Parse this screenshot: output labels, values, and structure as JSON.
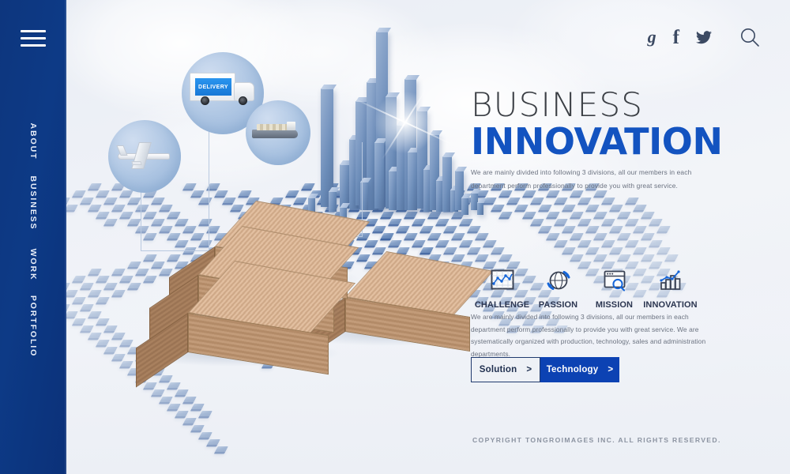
{
  "sidebar": {
    "menu_icon": "hamburger-menu-icon",
    "items": [
      {
        "label": "ABOUT"
      },
      {
        "label": "BUSINESS"
      },
      {
        "label": "WORK"
      },
      {
        "label": "PORTFOLIO"
      }
    ]
  },
  "header": {
    "icons": [
      {
        "name": "google-plus-icon",
        "glyph": "g"
      },
      {
        "name": "facebook-icon",
        "glyph": "f"
      },
      {
        "name": "twitter-icon",
        "glyph": "twitter-bird"
      },
      {
        "name": "search-icon",
        "glyph": "magnifier"
      }
    ]
  },
  "hero": {
    "title_line1": "BUSINESS",
    "title_line2": "INNOVATION",
    "lead_paragraph": "We are mainly divided into following 3 divisions, all our members in each department perform professionally to provide you with great service."
  },
  "features": [
    {
      "label": "CHALLENGE",
      "icon": "line-chart-frame-icon"
    },
    {
      "label": "PASSION",
      "icon": "globe-refresh-icon"
    },
    {
      "label": "MISSION",
      "icon": "browser-search-icon"
    },
    {
      "label": "INNOVATION",
      "icon": "bar-chart-trend-icon"
    }
  ],
  "body": {
    "paragraph": "We are mainly divided into following 3 divisions, all our members in each department perform professionally to provide you with great service. We are systematically organized with production, technology, sales and administration departments."
  },
  "buttons": {
    "solution": {
      "label": "Solution",
      "chevron": ">"
    },
    "technology": {
      "label": "Technology",
      "chevron": ">"
    }
  },
  "footer": {
    "copyright": "COPYRIGHT TONGROIMAGES INC. ALL RIGHTS RESERVED."
  },
  "illustration": {
    "callouts": [
      {
        "name": "airplane-callout",
        "label": ""
      },
      {
        "name": "delivery-truck-callout",
        "label": "DELIVERY"
      },
      {
        "name": "cargo-ship-callout",
        "label": ""
      }
    ]
  },
  "colors": {
    "sidebar_blue": "#0d3a86",
    "accent_blue": "#1353c0",
    "button_blue": "#0c42b3",
    "title_gray": "#3b3f45",
    "body_gray": "#6b7280",
    "container_tan": "#c29b79",
    "tile_blue": "#6e8fbe"
  }
}
